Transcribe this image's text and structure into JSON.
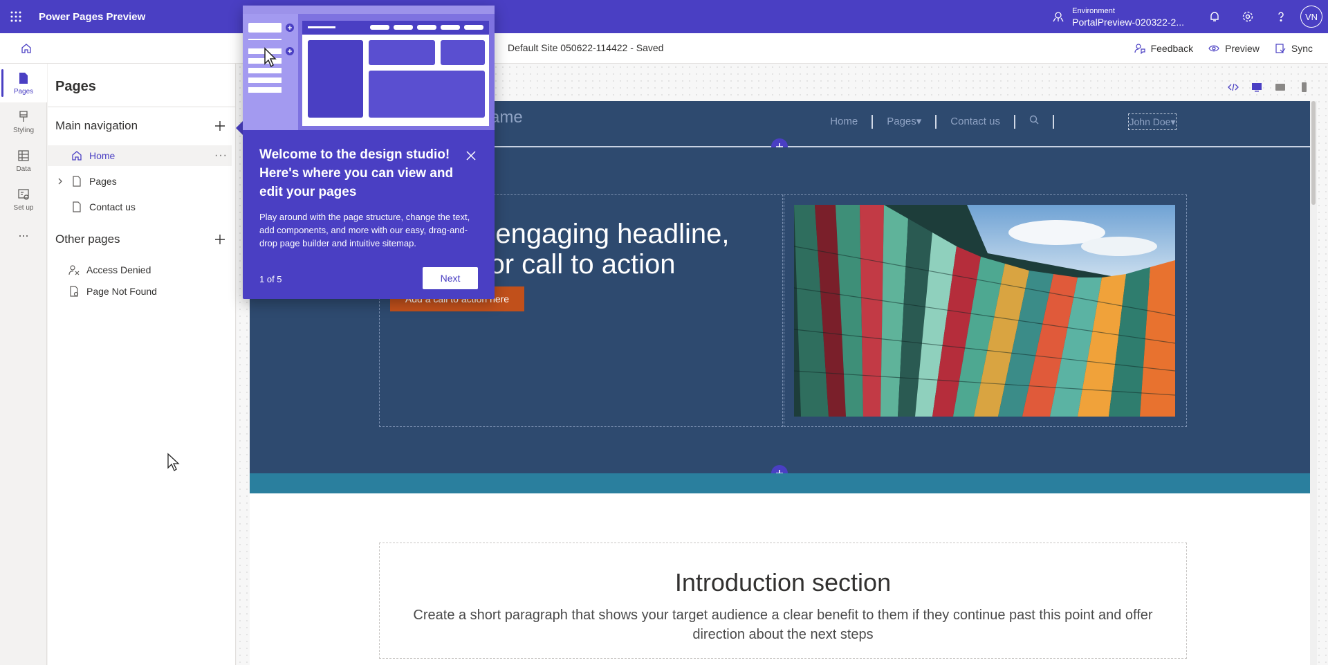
{
  "topbar": {
    "app_title": "Power Pages Preview",
    "environment_label": "Environment",
    "environment_name": "PortalPreview-020322-2...",
    "avatar_initials": "VN"
  },
  "cmdbar": {
    "site_status": "Default Site 050622-114422 - Saved",
    "feedback_label": "Feedback",
    "preview_label": "Preview",
    "sync_label": "Sync"
  },
  "rail": {
    "items": [
      {
        "label": "Pages",
        "icon": "pages-icon"
      },
      {
        "label": "Styling",
        "icon": "brush-icon"
      },
      {
        "label": "Data",
        "icon": "table-icon"
      },
      {
        "label": "Set up",
        "icon": "setup-icon"
      }
    ],
    "more": "..."
  },
  "pages_panel": {
    "title": "Pages",
    "main_nav_title": "Main navigation",
    "main_nav": [
      {
        "label": "Home",
        "icon": "home-icon",
        "selected": true
      },
      {
        "label": "Pages",
        "icon": "page-icon",
        "expandable": true
      },
      {
        "label": "Contact us",
        "icon": "page-icon"
      }
    ],
    "more_glyph": "···",
    "other_pages_title": "Other pages",
    "other_pages": [
      {
        "label": "Access Denied",
        "icon": "access-denied-icon"
      },
      {
        "label": "Page Not Found",
        "icon": "page-not-found-icon"
      }
    ]
  },
  "site": {
    "name": "ame",
    "nav": [
      "Home",
      "Pages▾",
      "Contact us"
    ],
    "user": "John Doe▾",
    "headline": "n engaging headline, e, or call to action",
    "headline_line1": "n engaging headline,",
    "headline_line2": "e, or call to action",
    "cta": "Add a call to action here",
    "intro_title": "Introduction section",
    "intro_text": "Create a short paragraph that shows your target audience a clear benefit to them if they continue past this point and offer direction about the next steps"
  },
  "bubble": {
    "title": "Welcome to the design studio! Here's where you can view and edit your pages",
    "body": "Play around with the page structure, change the text, add components, and more with our easy, drag-and-drop page builder and intuitive sitemap.",
    "step": "1 of 5",
    "next_label": "Next"
  },
  "colors": {
    "brand": "#4a3fc3",
    "site_header": "#2e4a6f",
    "cta": "#c1501b",
    "teal": "#2a7f9e"
  }
}
